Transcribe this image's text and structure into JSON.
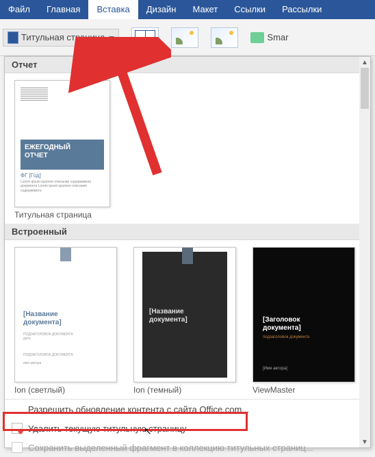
{
  "tabs": {
    "file": "Файл",
    "home": "Главная",
    "insert": "Вставка",
    "design": "Дизайн",
    "layout": "Макет",
    "references": "Ссылки",
    "mailings": "Рассылки"
  },
  "ribbon": {
    "cover_page_label": "Титульная страница",
    "smart": "Smar"
  },
  "sections": {
    "report": "Отчет",
    "builtin": "Встроенный"
  },
  "report_item": {
    "caption": "Титульная страница",
    "title_line1": "ЕЖЕГОДНЫЙ",
    "title_line2": "ОТЧЕТ",
    "sub": "ФГ [Год]"
  },
  "builtin": {
    "ion_light": {
      "caption": "Ion (светлый)",
      "title1": "[Название",
      "title2": "документа]"
    },
    "ion_dark": {
      "caption": "Ion (темный)",
      "title1": "[Название",
      "title2": "документа]"
    },
    "viewmaster": {
      "caption": "ViewMaster",
      "title1": "[Заголовок",
      "title2": "документа]",
      "author": "[Имя автора]"
    }
  },
  "footer": {
    "allow_update": "Разрешить обновление контента с сайта Office.com...",
    "remove_cover": "Удалить текущую титульную страницу",
    "save_selection": "Сохранить выделенный фрагмент в коллекцию титульных страниц..."
  }
}
